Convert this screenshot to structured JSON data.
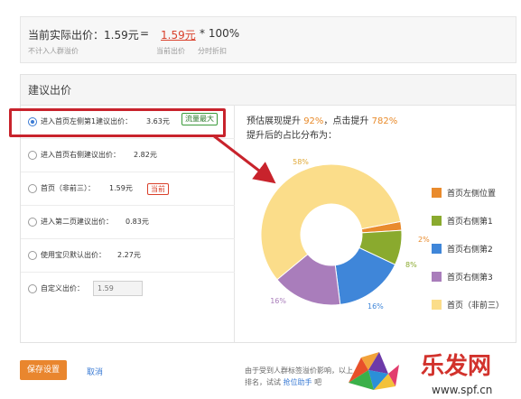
{
  "top": {
    "label": "当前实际出价：",
    "value": "1.59元",
    "equals": "=",
    "discount_price": "1.59元",
    "times": "* 100%",
    "sub_left": "不计入人群溢价",
    "sub_mid": "当前出价",
    "sub_right": "分时折扣"
  },
  "suggest": {
    "title": "建议出价",
    "options": [
      {
        "label": "进入首页左侧第1建议出价：",
        "price": "3.63元",
        "badge": "流量最大",
        "checked": true
      },
      {
        "label": "进入首页右侧建议出价：",
        "price": "2.82元"
      },
      {
        "label": "首页（非前三）：",
        "price": "1.59元",
        "badge": "当前"
      },
      {
        "label": "进入第二页建议出价：",
        "price": "0.83元"
      },
      {
        "label": "使用宝贝默认出价：",
        "price": "2.27元"
      },
      {
        "label": "自定义出价：",
        "input_placeholder": "1.59"
      }
    ]
  },
  "estimate": {
    "line1_a": "预估展现提升",
    "line1_b": "92%",
    "line1_c": "，点击提升",
    "line1_d": "782%",
    "line2": "提升后的占比分布为："
  },
  "chart_data": {
    "type": "pie",
    "donut": true,
    "slices": [
      {
        "name": "首页左侧位置",
        "value": 2,
        "label": "2%",
        "color": "#e98b2d"
      },
      {
        "name": "首页右侧第1",
        "value": 8,
        "label": "8%",
        "color": "#8aaa2e"
      },
      {
        "name": "首页右侧第2",
        "value": 16,
        "label": "16%",
        "color": "#3f86d9"
      },
      {
        "name": "首页右侧第3",
        "value": 16,
        "label": "16%",
        "color": "#a97dbb"
      },
      {
        "name": "首页（非前三）",
        "value": 58,
        "label": "58%",
        "color": "#fbdd8a"
      }
    ],
    "legend_position": "right"
  },
  "bottom": {
    "save_label": "保存设置",
    "cancel_label": "取消",
    "note1": "由于受到人群标签溢价影响，以上",
    "note2_a": "排名，试试",
    "note2_link": "抢位助手",
    "note2_b": "吧"
  },
  "watermark": {
    "text": "乐发网",
    "url": "www.spf.cn"
  }
}
